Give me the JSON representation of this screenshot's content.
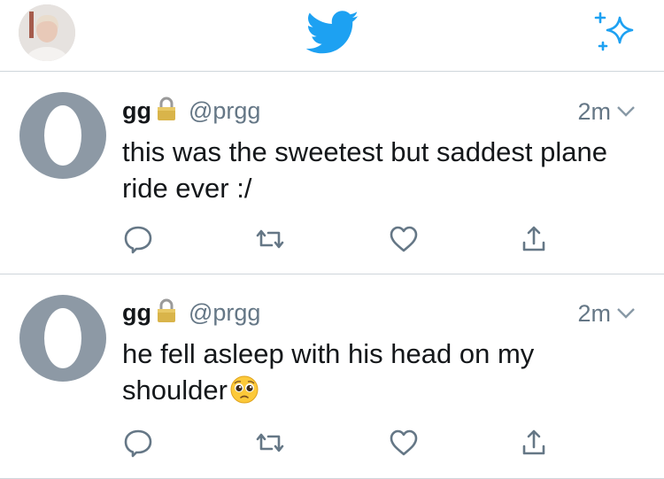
{
  "header": {
    "icons": [
      "profile-avatar",
      "twitter-bird-icon",
      "sparkle-icon"
    ]
  },
  "tweets": [
    {
      "name": "gg",
      "handle": "@prgg",
      "time": "2m",
      "text": "this was the sweetest but saddest plane ride ever :/",
      "emoji": ""
    },
    {
      "name": "gg",
      "handle": "@prgg",
      "time": "2m",
      "text": "he fell asleep with his head on my shoulder",
      "emoji": "pleading-face-emoji"
    }
  ],
  "colors": {
    "accent": "#1da1f2",
    "secondary_text": "#657786",
    "action_icon": "#657786",
    "divider": "#cfd6db",
    "egg_avatar": "#8d99a5"
  }
}
